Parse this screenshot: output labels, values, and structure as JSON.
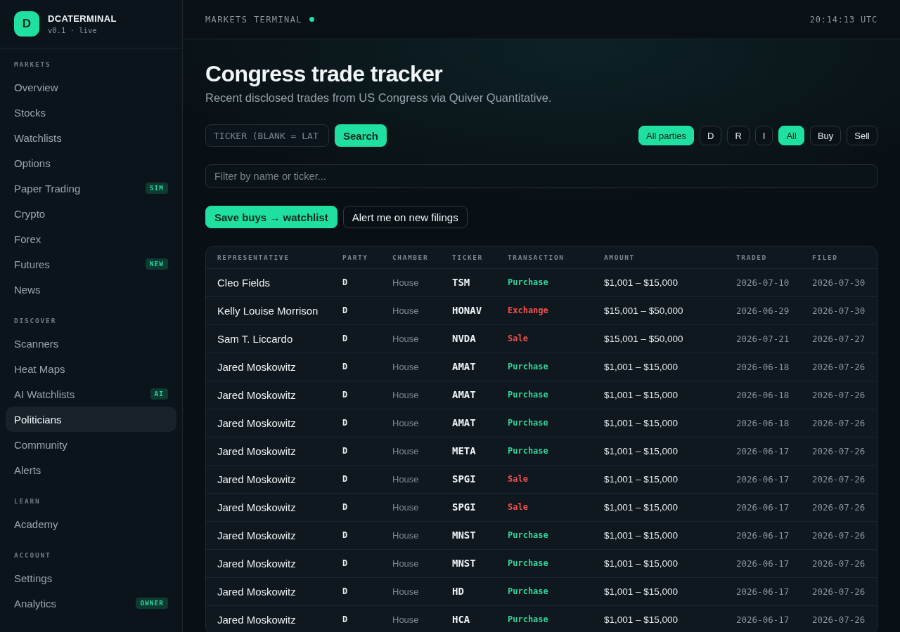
{
  "sidebar": {
    "brand": {
      "logo": "D",
      "name": "DCATERMINAL",
      "version": "v0.1 · live"
    },
    "sections": [
      {
        "label": "MARKETS",
        "items": [
          {
            "label": "Overview",
            "selected": false
          },
          {
            "label": "Stocks",
            "selected": false
          },
          {
            "label": "Watchlists",
            "selected": false
          },
          {
            "label": "Options",
            "selected": false
          },
          {
            "label": "Paper Trading",
            "selected": false,
            "badge": "SIM"
          },
          {
            "label": "Crypto",
            "selected": false
          },
          {
            "label": "Forex",
            "selected": false
          },
          {
            "label": "Futures",
            "selected": false,
            "badge": "NEW"
          },
          {
            "label": "News",
            "selected": false
          }
        ]
      },
      {
        "label": "DISCOVER",
        "items": [
          {
            "label": "Scanners",
            "selected": false
          },
          {
            "label": "Heat Maps",
            "selected": false
          },
          {
            "label": "AI Watchlists",
            "selected": false,
            "badge": "AI"
          },
          {
            "label": "Politicians",
            "selected": true
          },
          {
            "label": "Community",
            "selected": false
          },
          {
            "label": "Alerts",
            "selected": false
          }
        ]
      },
      {
        "label": "LEARN",
        "items": [
          {
            "label": "Academy",
            "selected": false
          }
        ]
      },
      {
        "label": "ACCOUNT",
        "items": [
          {
            "label": "Settings",
            "selected": false
          },
          {
            "label": "Analytics",
            "selected": false,
            "badge": "OWNER"
          }
        ]
      }
    ]
  },
  "topbar": {
    "title": "MARKETS TERMINAL",
    "live": true,
    "clock": "20:14:13 UTC"
  },
  "page": {
    "title": "Congress trade tracker",
    "subtitle": "Recent disclosed trades from US Congress via Quiver Quantitative."
  },
  "search": {
    "placeholder": "TICKER (BLANK = LAT",
    "button": "Search"
  },
  "party_filters": [
    {
      "label": "All parties",
      "selected": true
    },
    {
      "label": "D",
      "selected": false
    },
    {
      "label": "R",
      "selected": false
    },
    {
      "label": "I",
      "selected": false
    }
  ],
  "type_filters": [
    {
      "label": "All",
      "selected": true
    },
    {
      "label": "Buy",
      "selected": false
    },
    {
      "label": "Sell",
      "selected": false
    }
  ],
  "filter": {
    "placeholder": "Filter by name or ticker..."
  },
  "actions": [
    {
      "label": "Save buys → watchlist",
      "kind": "primary"
    },
    {
      "label": "Alert me on new filings",
      "kind": "secondary"
    }
  ],
  "table": {
    "columns": [
      "REPRESENTATIVE",
      "PARTY",
      "CHAMBER",
      "TICKER",
      "TRANSACTION",
      "AMOUNT",
      "TRADED",
      "FILED"
    ],
    "rows": [
      {
        "representative": "Cleo Fields",
        "party": "D",
        "chamber": "House",
        "ticker": "TSM",
        "transaction": {
          "label": "Purchase",
          "kind": "buy"
        },
        "amount": "$1,001 – $15,000",
        "traded": "2026-07-10",
        "filed": "2026-07-30"
      },
      {
        "representative": "Kelly Louise Morrison",
        "party": "D",
        "chamber": "House",
        "ticker": "HONAV",
        "transaction": {
          "label": "Exchange",
          "kind": "exchange"
        },
        "amount": "$15,001 – $50,000",
        "traded": "2026-06-29",
        "filed": "2026-07-30"
      },
      {
        "representative": "Sam T. Liccardo",
        "party": "D",
        "chamber": "House",
        "ticker": "NVDA",
        "transaction": {
          "label": "Sale",
          "kind": "sell"
        },
        "amount": "$15,001 – $50,000",
        "traded": "2026-07-21",
        "filed": "2026-07-27"
      },
      {
        "representative": "Jared Moskowitz",
        "party": "D",
        "chamber": "House",
        "ticker": "AMAT",
        "transaction": {
          "label": "Purchase",
          "kind": "buy"
        },
        "amount": "$1,001 – $15,000",
        "traded": "2026-06-18",
        "filed": "2026-07-26"
      },
      {
        "representative": "Jared Moskowitz",
        "party": "D",
        "chamber": "House",
        "ticker": "AMAT",
        "transaction": {
          "label": "Purchase",
          "kind": "buy"
        },
        "amount": "$1,001 – $15,000",
        "traded": "2026-06-18",
        "filed": "2026-07-26"
      },
      {
        "representative": "Jared Moskowitz",
        "party": "D",
        "chamber": "House",
        "ticker": "AMAT",
        "transaction": {
          "label": "Purchase",
          "kind": "buy"
        },
        "amount": "$1,001 – $15,000",
        "traded": "2026-06-18",
        "filed": "2026-07-26"
      },
      {
        "representative": "Jared Moskowitz",
        "party": "D",
        "chamber": "House",
        "ticker": "META",
        "transaction": {
          "label": "Purchase",
          "kind": "buy"
        },
        "amount": "$1,001 – $15,000",
        "traded": "2026-06-17",
        "filed": "2026-07-26"
      },
      {
        "representative": "Jared Moskowitz",
        "party": "D",
        "chamber": "House",
        "ticker": "SPGI",
        "transaction": {
          "label": "Sale",
          "kind": "sell"
        },
        "amount": "$1,001 – $15,000",
        "traded": "2026-06-17",
        "filed": "2026-07-26"
      },
      {
        "representative": "Jared Moskowitz",
        "party": "D",
        "chamber": "House",
        "ticker": "SPGI",
        "transaction": {
          "label": "Sale",
          "kind": "sell"
        },
        "amount": "$1,001 – $15,000",
        "traded": "2026-06-17",
        "filed": "2026-07-26"
      },
      {
        "representative": "Jared Moskowitz",
        "party": "D",
        "chamber": "House",
        "ticker": "MNST",
        "transaction": {
          "label": "Purchase",
          "kind": "buy"
        },
        "amount": "$1,001 – $15,000",
        "traded": "2026-06-17",
        "filed": "2026-07-26"
      },
      {
        "representative": "Jared Moskowitz",
        "party": "D",
        "chamber": "House",
        "ticker": "MNST",
        "transaction": {
          "label": "Purchase",
          "kind": "buy"
        },
        "amount": "$1,001 – $15,000",
        "traded": "2026-06-17",
        "filed": "2026-07-26"
      },
      {
        "representative": "Jared Moskowitz",
        "party": "D",
        "chamber": "House",
        "ticker": "HD",
        "transaction": {
          "label": "Purchase",
          "kind": "buy"
        },
        "amount": "$1,001 – $15,000",
        "traded": "2026-06-17",
        "filed": "2026-07-26"
      },
      {
        "representative": "Jared Moskowitz",
        "party": "D",
        "chamber": "House",
        "ticker": "HCA",
        "transaction": {
          "label": "Purchase",
          "kind": "buy"
        },
        "amount": "$1,001 – $15,000",
        "traded": "2026-06-17",
        "filed": "2026-07-26"
      }
    ]
  }
}
